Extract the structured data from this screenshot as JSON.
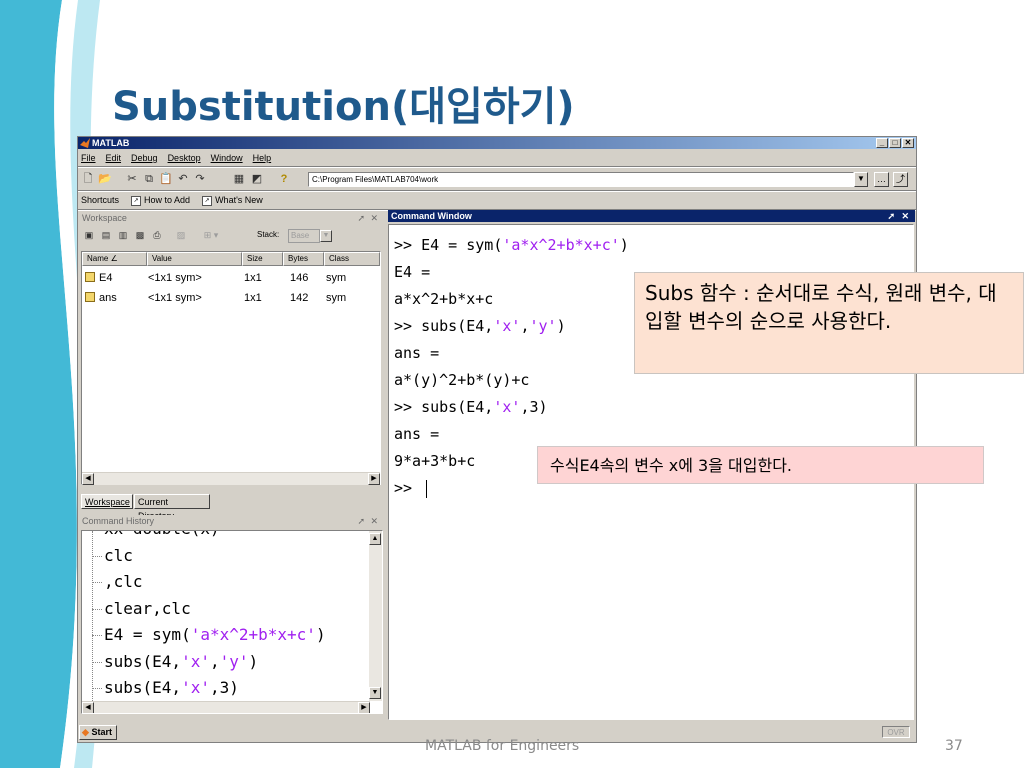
{
  "slide": {
    "title": "Substitution(대입하기)",
    "footer": "MATLAB for Engineers",
    "page_number": "37"
  },
  "window": {
    "title": "MATLAB",
    "controls": [
      "_",
      "□",
      "✕"
    ],
    "menu": [
      "File",
      "Edit",
      "Debug",
      "Desktop",
      "Window",
      "Help"
    ],
    "current_directory": "C:\\Program Files\\MATLAB704\\work",
    "shortcuts": [
      "Shortcuts",
      "How to Add",
      "What's New"
    ]
  },
  "workspace": {
    "title": "Workspace",
    "stack_label": "Stack:",
    "stack_value": "Base",
    "columns": [
      "Name ∠",
      "Value",
      "Size",
      "Bytes",
      "Class"
    ],
    "rows": [
      {
        "name": "E4",
        "value": "<1x1 sym>",
        "size": "1x1",
        "bytes": "146",
        "class": "sym"
      },
      {
        "name": "ans",
        "value": "<1x1 sym>",
        "size": "1x1",
        "bytes": "142",
        "class": "sym"
      }
    ],
    "tabs": [
      "Workspace",
      "Current Directory"
    ]
  },
  "history": {
    "title": "Command History",
    "lines": [
      {
        "parts": [
          {
            "t": "xx=double(x)",
            "s": false
          }
        ]
      },
      {
        "parts": [
          {
            "t": "clc",
            "s": false
          }
        ]
      },
      {
        "parts": [
          {
            "t": ",clc",
            "s": false
          }
        ]
      },
      {
        "parts": [
          {
            "t": "clear,clc",
            "s": false
          }
        ]
      },
      {
        "parts": [
          {
            "t": "E4 = sym(",
            "s": false
          },
          {
            "t": "'a*x^2+b*x+c'",
            "s": true
          },
          {
            "t": ")",
            "s": false
          }
        ]
      },
      {
        "parts": [
          {
            "t": "subs(E4,",
            "s": false
          },
          {
            "t": "'x'",
            "s": true
          },
          {
            "t": ",",
            "s": false
          },
          {
            "t": "'y'",
            "s": true
          },
          {
            "t": ")",
            "s": false
          }
        ]
      },
      {
        "parts": [
          {
            "t": "subs(E4,",
            "s": false
          },
          {
            "t": "'x'",
            "s": true
          },
          {
            "t": ",3)",
            "s": false
          }
        ]
      }
    ]
  },
  "command_window": {
    "title": "Command Window",
    "lines": [
      {
        "parts": [
          {
            "t": ">> E4 = sym(",
            "s": false
          },
          {
            "t": "'a*x^2+b*x+c'",
            "s": true
          },
          {
            "t": ")",
            "s": false
          }
        ]
      },
      {
        "parts": [
          {
            "t": "E4 =",
            "s": false
          }
        ]
      },
      {
        "parts": [
          {
            "t": "a*x^2+b*x+c",
            "s": false
          }
        ]
      },
      {
        "parts": [
          {
            "t": ">> subs(E4,",
            "s": false
          },
          {
            "t": "'x'",
            "s": true
          },
          {
            "t": ",",
            "s": false
          },
          {
            "t": "'y'",
            "s": true
          },
          {
            "t": ")",
            "s": false
          }
        ]
      },
      {
        "parts": [
          {
            "t": "ans =",
            "s": false
          }
        ]
      },
      {
        "parts": [
          {
            "t": "a*(y)^2+b*(y)+c",
            "s": false
          }
        ]
      },
      {
        "parts": [
          {
            "t": ">> subs(E4,",
            "s": false
          },
          {
            "t": "'x'",
            "s": true
          },
          {
            "t": ",3)",
            "s": false
          }
        ]
      },
      {
        "parts": [
          {
            "t": "ans =",
            "s": false
          }
        ]
      },
      {
        "parts": [
          {
            "t": "9*a+3*b+c",
            "s": false
          }
        ]
      },
      {
        "parts": [
          {
            "t": ">>",
            "s": false
          }
        ],
        "cursor": true
      }
    ]
  },
  "status": {
    "start_label": "Start",
    "ovr": "OVR"
  },
  "callouts": {
    "subs_note": "Subs 함수 : 순서대로 수식, 원래 변수, 대입할 변수의 순으로 사용한다.",
    "substitute_note": "수식E4속의 변수 x에 3을 대입한다."
  },
  "colors": {
    "title": "#1f5a8c",
    "string_literal": "#a020f0",
    "titlebar_active": "#0a246a",
    "callout_peach": "#fde2d2",
    "callout_pink": "#fed4d4"
  }
}
